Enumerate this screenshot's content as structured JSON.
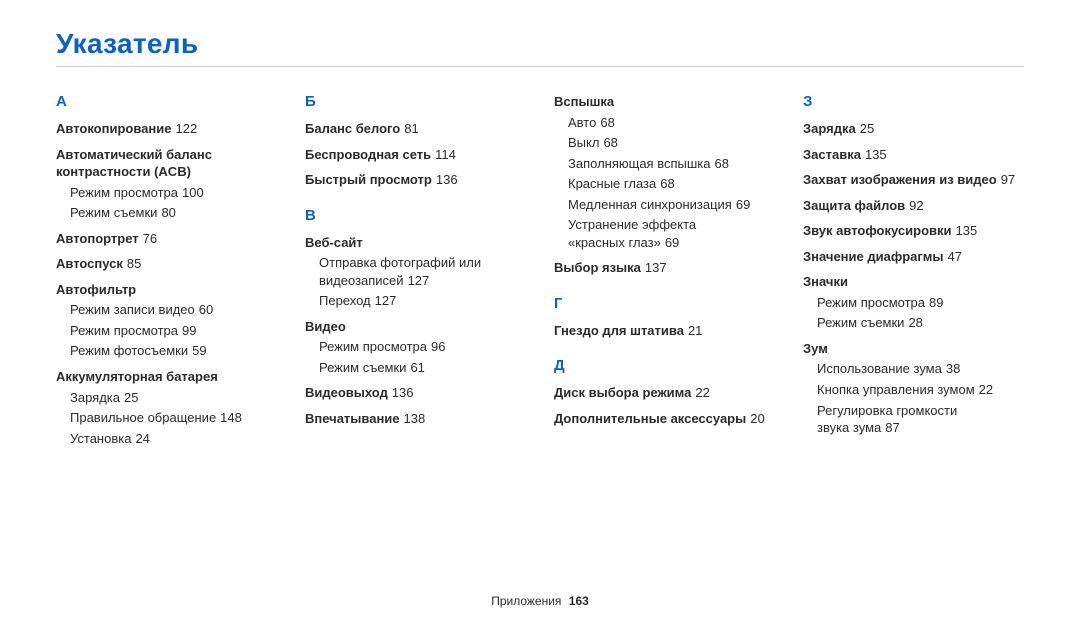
{
  "title": "Указатель",
  "footer": {
    "section": "Приложения",
    "page": "163"
  },
  "col1": {
    "letter": "А",
    "e_autokop": "Автокопирование",
    "p_autokop": "122",
    "e_acb_l1": "Автоматический баланс",
    "e_acb_l2": "контрастности (ACB)",
    "s_acb1": "Режим просмотра",
    "p_acb1": "100",
    "s_acb2": "Режим съемки",
    "p_acb2": "80",
    "e_selfp": "Автопортрет",
    "p_selfp": "76",
    "e_timer": "Автоспуск",
    "p_timer": "85",
    "e_autofilter": "Автофильтр",
    "s_af1": "Режим записи видео",
    "p_af1": "60",
    "s_af2": "Режим просмотра",
    "p_af2": "99",
    "s_af3": "Режим фотосъемки",
    "p_af3": "59",
    "e_batt": "Аккумуляторная батарея",
    "s_b1": "Зарядка",
    "p_b1": "25",
    "s_b2": "Правильное обращение",
    "p_b2": "148",
    "s_b3": "Установка",
    "p_b3": "24"
  },
  "col2": {
    "letterB": "Б",
    "e_wb": "Баланс белого",
    "p_wb": "81",
    "e_wifi": "Беспроводная сеть",
    "p_wifi": "114",
    "e_quick": "Быстрый просмотр",
    "p_quick": "136",
    "letterV": "В",
    "e_web": "Веб-сайт",
    "s_web1_l1": "Отправка фотографий или",
    "s_web1_l2": "видеозаписей",
    "p_web1": "127",
    "s_web2": "Переход",
    "p_web2": "127",
    "e_video": "Видео",
    "s_v1": "Режим просмотра",
    "p_v1": "96",
    "s_v2": "Режим съемки",
    "p_v2": "61",
    "e_vout": "Видеовыход",
    "p_vout": "136",
    "e_imprint": "Впечатывание",
    "p_imprint": "138"
  },
  "col3": {
    "e_flash": "Вспышка",
    "s_f1": "Авто",
    "p_f1": "68",
    "s_f2": "Выкл",
    "p_f2": "68",
    "s_f3": "Заполняющая вспышка",
    "p_f3": "68",
    "s_f4": "Красные глаза",
    "p_f4": "68",
    "s_f5": "Медленная синхронизация",
    "p_f5": "69",
    "s_f6_l1": "Устранение эффекта",
    "s_f6_l2": "«красных глаз»",
    "p_f6": "69",
    "e_lang": "Выбор языка",
    "p_lang": "137",
    "letterG": "Г",
    "e_tripod": "Гнездо для штатива",
    "p_tripod": "21",
    "letterD": "Д",
    "e_modedial": "Диск выбора режима",
    "p_modedial": "22",
    "e_acc": "Дополнительные аксессуары",
    "p_acc": "20"
  },
  "col4": {
    "letterZ": "З",
    "e_charge": "Зарядка",
    "p_charge": "25",
    "e_saver": "Заставка",
    "p_saver": "135",
    "e_capvid": "Захват изображения из видео",
    "p_capvid": "97",
    "e_protect": "Защита файлов",
    "p_protect": "92",
    "e_afsound": "Звук автофокусировки",
    "p_afsound": "135",
    "e_aperture": "Значение диафрагмы",
    "p_aperture": "47",
    "e_icons": "Значки",
    "s_i1": "Режим просмотра",
    "p_i1": "89",
    "s_i2": "Режим съемки",
    "p_i2": "28",
    "e_zoom": "Зум",
    "s_z1": "Использование зума",
    "p_z1": "38",
    "s_z2": "Кнопка управления зумом",
    "p_z2": "22",
    "s_z3_l1": "Регулировка громкости",
    "s_z3_l2": "звука зума",
    "p_z3": "87"
  }
}
